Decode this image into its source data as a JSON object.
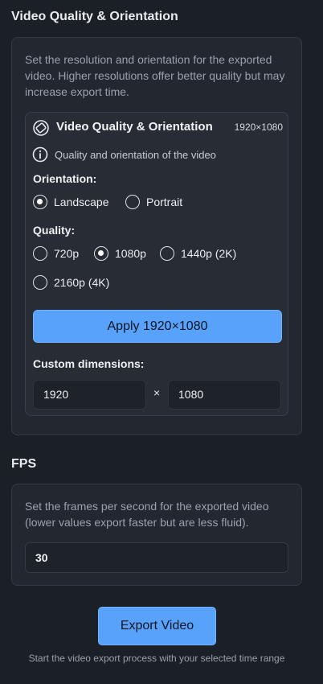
{
  "quality_section": {
    "title": "Video Quality & Orientation",
    "description": "Set the resolution and orientation for the exported video. Higher resolutions offer better quality but may increase export time.",
    "card": {
      "title": "Video Quality & Orientation",
      "resolution_badge": "1920×1080",
      "icon": "aspect-ratio-icon",
      "info_icon": "info-icon",
      "info_text": "Quality and orientation of the video",
      "orientation_label": "Orientation:",
      "orientation_options": [
        {
          "label": "Landscape",
          "checked": true
        },
        {
          "label": "Portrait",
          "checked": false
        }
      ],
      "quality_label": "Quality:",
      "quality_options": [
        {
          "label": "720p",
          "checked": false
        },
        {
          "label": "1080p",
          "checked": true
        },
        {
          "label": "1440p (2K)",
          "checked": false
        },
        {
          "label": "2160p (4K)",
          "checked": false
        }
      ],
      "apply_label": "Apply 1920×1080",
      "custom_label": "Custom dimensions:",
      "width_value": "1920",
      "times_symbol": "×",
      "height_value": "1080"
    }
  },
  "fps_section": {
    "title": "FPS",
    "description": "Set the frames per second for the exported video (lower values export faster but are less fluid).",
    "value": "30"
  },
  "export": {
    "button_label": "Export Video",
    "caption": "Start the video export process with your selected time range"
  },
  "colors": {
    "accent": "#58a2fb",
    "background": "#1b1f26",
    "panel": "#232830"
  }
}
